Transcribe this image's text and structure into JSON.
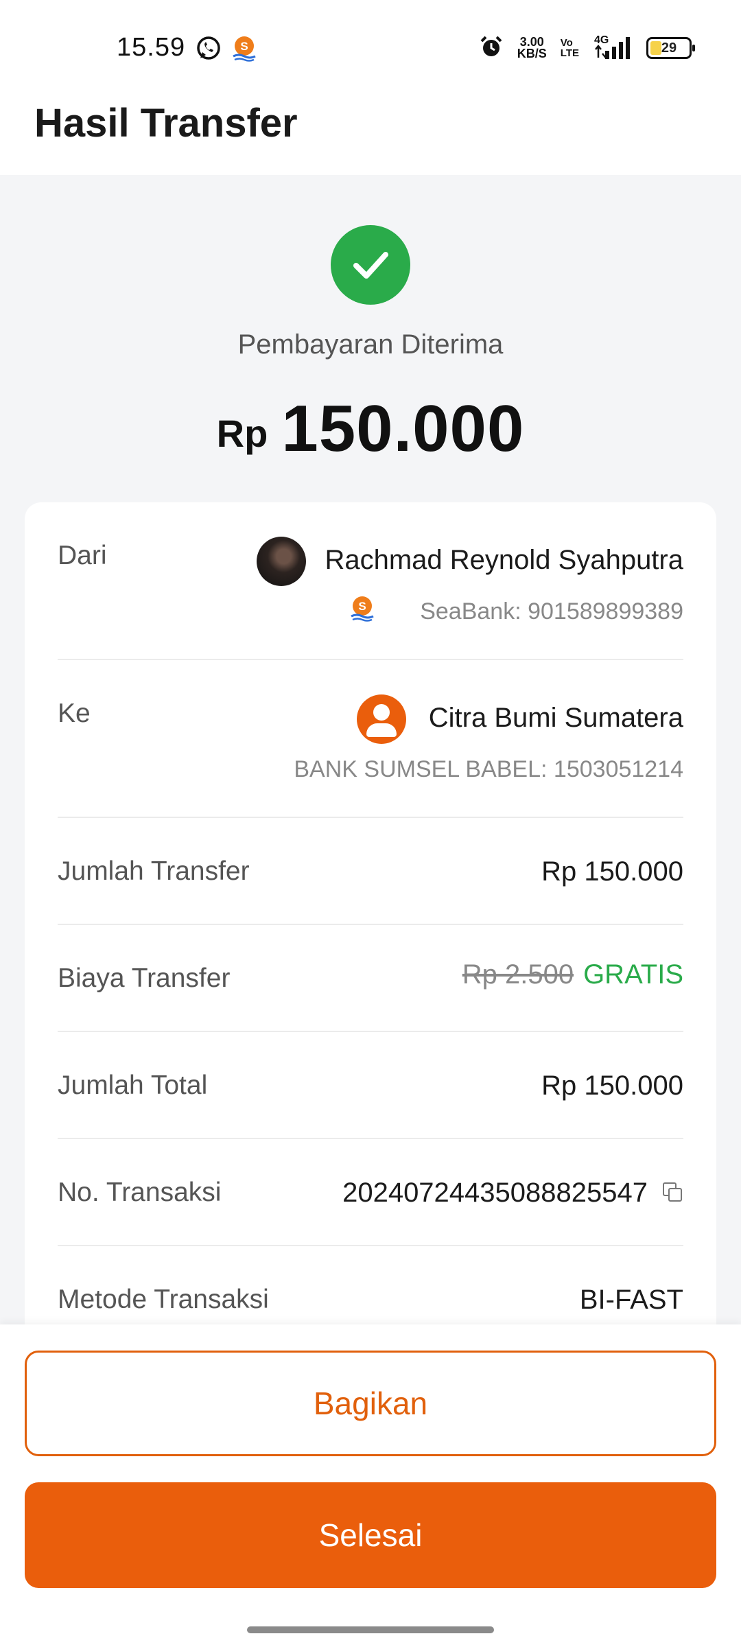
{
  "status_bar": {
    "time": "15.59",
    "net_speed_value": "3.00",
    "net_speed_unit": "KB/S",
    "volte_top": "Vo",
    "volte_bottom": "LTE",
    "network": "4G",
    "battery": "29"
  },
  "header": {
    "title": "Hasil Transfer"
  },
  "result": {
    "status": "Pembayaran Diterima",
    "currency": "Rp",
    "amount": "150.000",
    "accent_color": "#2aab4a"
  },
  "details": {
    "from": {
      "label": "Dari",
      "name": "Rachmad Reynold Syahputra",
      "account": "SeaBank: 901589899389"
    },
    "to": {
      "label": "Ke",
      "name": "Citra Bumi Sumatera",
      "account": "BANK SUMSEL BABEL: 1503051214"
    },
    "transfer_amount": {
      "label": "Jumlah Transfer",
      "value": "Rp 150.000"
    },
    "transfer_fee": {
      "label": "Biaya Transfer",
      "original": "Rp 2.500",
      "value": "GRATIS"
    },
    "total": {
      "label": "Jumlah Total",
      "value": "Rp 150.000"
    },
    "transaction_no": {
      "label": "No. Transaksi",
      "value": "20240724435088825547"
    },
    "method": {
      "label": "Metode Transaksi",
      "value": "BI-FAST"
    }
  },
  "actions": {
    "share": "Bagikan",
    "done": "Selesai",
    "brand_color": "#ea5e0c"
  }
}
